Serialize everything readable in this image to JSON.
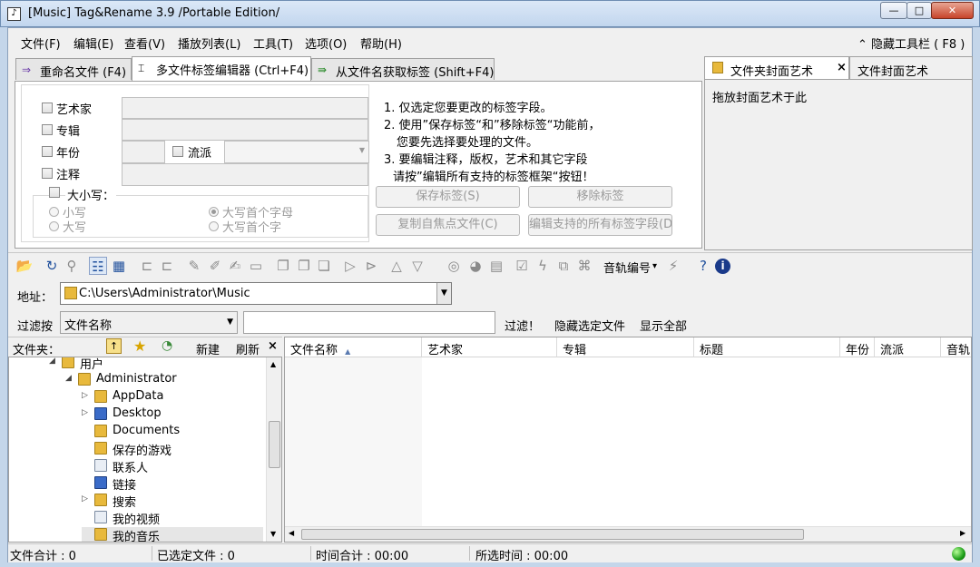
{
  "window": {
    "title": "[Music] Tag&Rename 3.9 /Portable Edition/",
    "buttons": {
      "minimize": "—",
      "maximize": "□",
      "close": "✕"
    }
  },
  "menu": {
    "items": [
      "文件(F)",
      "编辑(E)",
      "查看(V)",
      "播放列表(L)",
      "工具(T)",
      "选项(O)",
      "帮助(H)"
    ],
    "hide_toolbar": "⌃ 隐藏工具栏 ( F8 )"
  },
  "tabs": [
    {
      "label": "重命名文件 (F4)",
      "icon": "rename-arrow-icon"
    },
    {
      "label": "多文件标签编辑器 (Ctrl+F4)",
      "icon": "tag-editor-icon"
    },
    {
      "label": "从文件名获取标签 (Shift+F4)",
      "icon": "filename-to-tag-icon"
    }
  ],
  "editor": {
    "fields": {
      "artist": "艺术家",
      "album": "专辑",
      "year": "年份",
      "genre": "流派",
      "comment": "注释"
    },
    "case": {
      "label": "大小写：",
      "lower": "小写",
      "upper": "大写",
      "first_letter": "大写首个字母",
      "first_word": "大写首个字"
    },
    "instructions": [
      "1. 仅选定您要更改的标签字段。",
      "2. 使用”保存标签“和”移除标签“功能前，",
      "   您要先选择要处理的文件。",
      "3. 要编辑注释，版权，艺术和其它字段",
      "   请按”编辑所有支持的标签框架“按钮！"
    ],
    "buttons": {
      "save_tags": "保存标签(S)",
      "remove_tags": "移除标签",
      "copy_from_focus": "复制自焦点文件(C)",
      "edit_all_frames": "编辑支持的所有标签字段(D"
    }
  },
  "cover": {
    "tab_folder": "文件夹封面艺术",
    "tab_file": "文件封面艺术",
    "close": "×",
    "hint": "拖放封面艺术于此"
  },
  "toolbar": {
    "track_number": "音轨编号",
    "dropdown_caret": "▾"
  },
  "address": {
    "label": "地址：",
    "path": "C:\\Users\\Administrator\\Music"
  },
  "filter": {
    "label": "过滤按",
    "field": "文件名称",
    "value": "",
    "filter_btn": "过滤！",
    "hide_selected_btn": "隐藏选定文件",
    "show_all_btn": "显示全部"
  },
  "folders": {
    "label": "文件夹：",
    "new_btn": "新建",
    "refresh_btn": "刷新",
    "close": "×",
    "tree": [
      {
        "label": "用户",
        "expanded": true
      },
      {
        "label": "Administrator",
        "expanded": true
      },
      {
        "label": "AppData"
      },
      {
        "label": "Desktop"
      },
      {
        "label": "Documents"
      },
      {
        "label": "保存的游戏"
      },
      {
        "label": "联系人"
      },
      {
        "label": "链接"
      },
      {
        "label": "搜索"
      },
      {
        "label": "我的视频"
      },
      {
        "label": "我的音乐"
      }
    ]
  },
  "file_list": {
    "columns": [
      "文件名称",
      "艺术家",
      "专辑",
      "标题",
      "年份",
      "流派",
      "音轨..."
    ],
    "sort_indicator": "▲",
    "rows": []
  },
  "status": {
    "file_total": "文件合计 : 0",
    "selected_files": "已选定文件 : 0",
    "time_total": "时间合计 : 00:00",
    "selected_time": "所选时间 : 00:00"
  }
}
